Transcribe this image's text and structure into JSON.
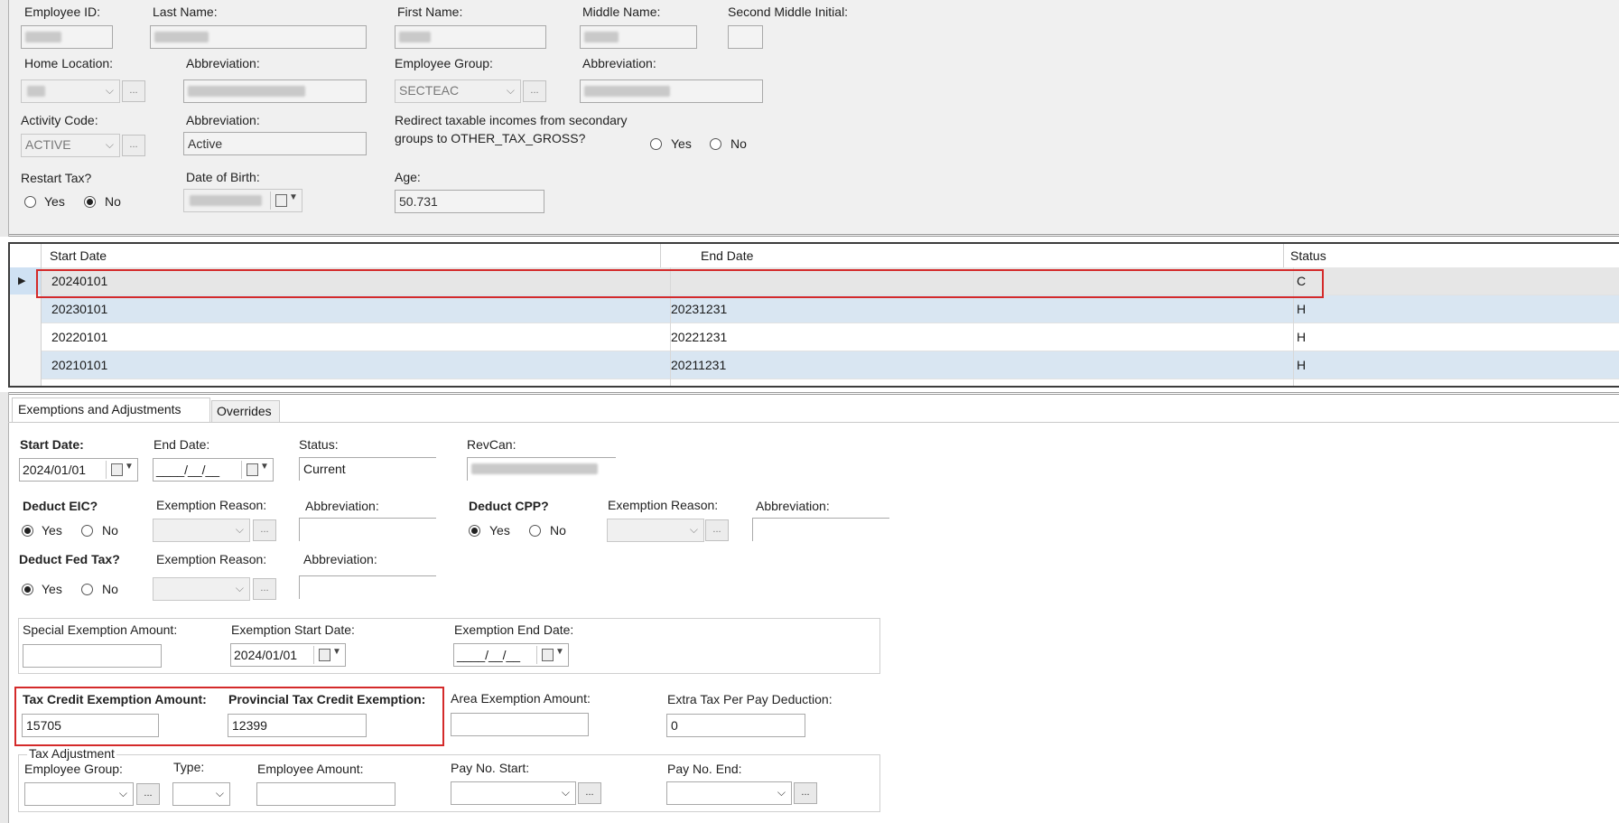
{
  "header": {
    "employee_id_label": "Employee ID:",
    "last_name_label": "Last Name:",
    "first_name_label": "First Name:",
    "middle_name_label": "Middle Name:",
    "second_middle_initial_label": "Second Middle Initial:",
    "home_location_label": "Home Location:",
    "abbreviation_label": "Abbreviation:",
    "employee_group_label": "Employee Group:",
    "employee_group_value": "SECTEAC",
    "activity_code_label": "Activity Code:",
    "activity_code_value": "ACTIVE",
    "activity_abbrev_value": "Active",
    "redirect_label_line1": "Redirect taxable incomes from secondary",
    "redirect_label_line2": "groups to OTHER_TAX_GROSS?",
    "yes_label": "Yes",
    "no_label": "No",
    "restart_tax_label": "Restart Tax?",
    "dob_label": "Date of Birth:",
    "age_label": "Age:",
    "age_value": "50.731",
    "ellipsis": "..."
  },
  "grid": {
    "columns": [
      "Start Date",
      "End Date",
      "Status"
    ],
    "rows": [
      {
        "start": "20240101",
        "end": "",
        "status": "C"
      },
      {
        "start": "20230101",
        "end": "20231231",
        "status": "H"
      },
      {
        "start": "20220101",
        "end": "20221231",
        "status": "H"
      },
      {
        "start": "20210101",
        "end": "20211231",
        "status": "H"
      }
    ]
  },
  "tabs": [
    "Exemptions and Adjustments",
    "Overrides"
  ],
  "detail": {
    "start_date_label": "Start Date:",
    "start_date_value": "2024/01/01",
    "end_date_label": "End Date:",
    "end_date_value": "____/__/__",
    "status_label": "Status:",
    "status_value": "Current",
    "revcan_label": "RevCan:",
    "deduct_eic_label": "Deduct EIC?",
    "exemption_reason_label": "Exemption Reason:",
    "abbreviation_label": "Abbreviation:",
    "deduct_cpp_label": "Deduct CPP?",
    "deduct_fed_tax_label": "Deduct Fed Tax?",
    "yes_label": "Yes",
    "no_label": "No",
    "special_exemption_label": "Special Exemption Amount:",
    "exemption_start_label": "Exemption Start Date:",
    "exemption_start_value": "2024/01/01",
    "exemption_end_label": "Exemption End Date:",
    "exemption_end_value": "____/__/__",
    "tax_credit_label": "Tax Credit Exemption Amount:",
    "tax_credit_value": "15705",
    "prov_tax_credit_label": "Provincial Tax Credit Exemption:",
    "prov_tax_credit_value": "12399",
    "area_exemption_label": "Area Exemption Amount:",
    "extra_tax_label": "Extra Tax Per Pay Deduction:",
    "extra_tax_value": "0",
    "tax_adjustment_label": "Tax Adjustment",
    "adj_employee_group_label": "Employee Group:",
    "type_label": "Type:",
    "employee_amount_label": "Employee Amount:",
    "pay_no_start_label": "Pay No. Start:",
    "pay_no_end_label": "Pay No. End:",
    "ellipsis": "..."
  }
}
